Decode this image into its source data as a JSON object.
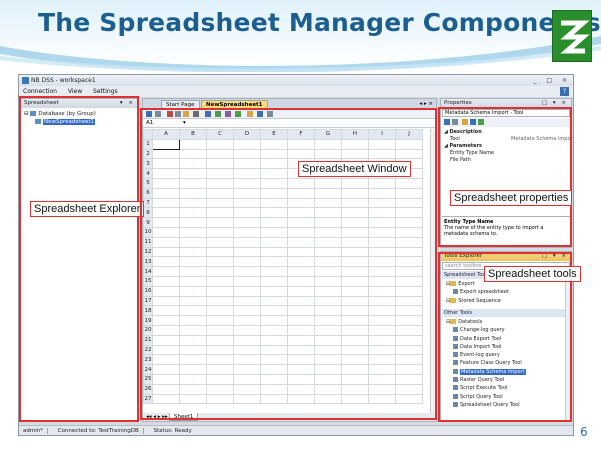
{
  "slide": {
    "title": "The Spreadsheet Manager Components",
    "page_number": "6"
  },
  "app": {
    "window_title": "NB DSS - workspace1",
    "menu": [
      "Connection",
      "View",
      "Settings"
    ],
    "colors": {
      "accent_tab": "#f9d97a",
      "selection": "#3169c6",
      "callout": "#e03030"
    }
  },
  "explorer": {
    "header": "Spreadsheet",
    "tree": [
      {
        "label": "Database (by Group)"
      },
      {
        "label": "NewSpreadsheet1",
        "selected": true
      }
    ]
  },
  "center": {
    "tabs": [
      {
        "label": "Start Page",
        "active": false
      },
      {
        "label": "NewSpreadsheet1",
        "active": true
      }
    ],
    "cell_ref": "A1",
    "columns": [
      "A",
      "B",
      "C",
      "D",
      "E",
      "F",
      "G",
      "H",
      "I",
      "J"
    ],
    "rows": [
      "1",
      "2",
      "3",
      "4",
      "5",
      "6",
      "7",
      "8",
      "9",
      "10",
      "11",
      "12",
      "13",
      "14",
      "15",
      "16",
      "17",
      "18",
      "19",
      "20",
      "21",
      "22",
      "23",
      "24",
      "25",
      "26",
      "27"
    ],
    "sheet_tab": "Sheet1"
  },
  "properties": {
    "header": "Properties",
    "combo": "Metadata Schema Import - Tool",
    "rows": [
      {
        "label": "Description",
        "value": "",
        "bold": true
      },
      {
        "label": "Tool",
        "value": "Metadata Schema Import",
        "bold": false
      },
      {
        "label": "Parameters",
        "value": "",
        "bold": true
      },
      {
        "label": "Entity Type Name",
        "value": "",
        "bold": false
      },
      {
        "label": "File Path",
        "value": "",
        "bold": false
      }
    ],
    "desc_title": "Entity Type Name",
    "desc_text": "The name of the entity type to import a metadata schema to."
  },
  "tools": {
    "header": "Tools Explorer",
    "search_placeholder": "search toolbox",
    "group1": "Spreadsheet Tools",
    "group1_items": [
      {
        "label": "Export",
        "folder": true,
        "indent": 1
      },
      {
        "label": "Export spreadsheet",
        "folder": false,
        "indent": 2
      },
      {
        "label": "Stored Sequence",
        "folder": true,
        "indent": 1
      }
    ],
    "group2": "Other Tools",
    "group2_items": [
      {
        "label": "Datatools",
        "folder": true,
        "indent": 1
      },
      {
        "label": "Change-log query",
        "folder": false,
        "indent": 2
      },
      {
        "label": "Data Export Tool",
        "folder": false,
        "indent": 2
      },
      {
        "label": "Data Import Tool",
        "folder": false,
        "indent": 2
      },
      {
        "label": "Event-log query",
        "folder": false,
        "indent": 2
      },
      {
        "label": "Feature Class Query Tool",
        "folder": false,
        "indent": 2
      },
      {
        "label": "Metadata Schema Import",
        "folder": false,
        "indent": 2,
        "selected": true
      },
      {
        "label": "Raster Query Tool",
        "folder": false,
        "indent": 2
      },
      {
        "label": "Script Execute Tool",
        "folder": false,
        "indent": 2
      },
      {
        "label": "Script Query Tool",
        "folder": false,
        "indent": 2
      },
      {
        "label": "Spreadsheet Query Tool",
        "folder": false,
        "indent": 2
      }
    ]
  },
  "statusbar": {
    "user": "admin*",
    "connection": "Connected to: TestTrainingDB",
    "status": "Status: Ready"
  },
  "callouts": {
    "explorer": "Spreadsheet Explorer",
    "window": "Spreadsheet Window",
    "properties": "Spreadsheet properties",
    "tools": "Spreadsheet tools"
  }
}
